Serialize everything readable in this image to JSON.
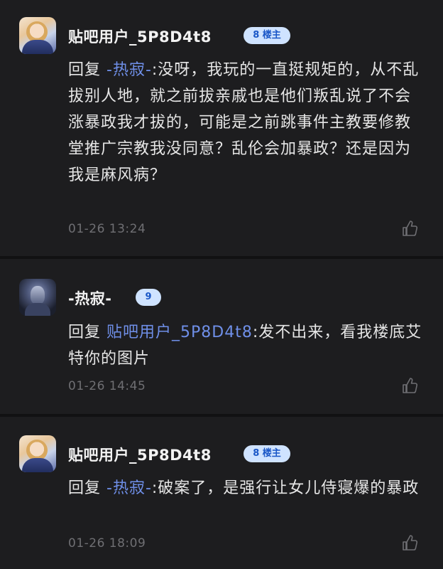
{
  "posts": [
    {
      "username": "贴吧用户_5P8D4t8",
      "badge": "8 楼主",
      "reply_prefix": "回复 ",
      "mention": "-热寂-",
      "content": ":没呀，我玩的一直挺规矩的，从不乱拔别人地，就之前拔亲戚也是他们叛乱说了不会涨暴政我才拔的，可能是之前跳事件主教要修教堂推广宗教我没同意？乱伦会加暴政？还是因为我是麻风病？",
      "time": "01-26 13:24",
      "like_icon": "thumbs-up-icon"
    },
    {
      "username": "-热寂-",
      "badge": "9",
      "reply_prefix": "回复 ",
      "mention": "贴吧用户_5P8D4t8",
      "content": ":发不出来，看我楼底艾特你的图片",
      "time": "01-26 14:45",
      "like_icon": "thumbs-up-icon"
    },
    {
      "username": "贴吧用户_5P8D4t8",
      "badge": "8 楼主",
      "reply_prefix": "回复 ",
      "mention": "-热寂-",
      "content": ":破案了，是强行让女儿侍寝爆的暴政",
      "time": "01-26 18:09",
      "like_icon": "thumbs-up-icon"
    }
  ],
  "colors": {
    "background": "#1d1d1f",
    "mention": "#6f8fe8",
    "badge_bg": "#cfe3ff",
    "badge_text": "#1a57c7"
  }
}
